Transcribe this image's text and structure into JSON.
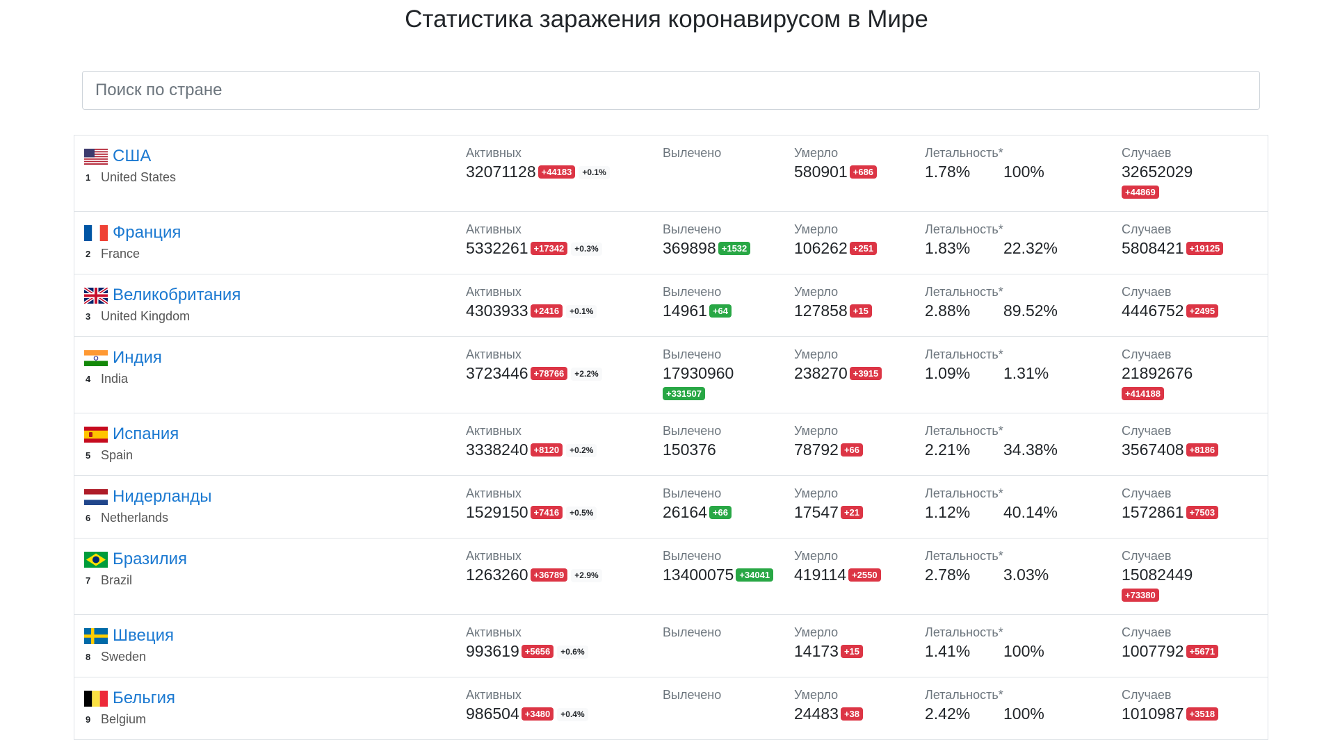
{
  "page": {
    "title": "Статистика заражения коронавирусом в Мире"
  },
  "search": {
    "placeholder": "Поиск по стране"
  },
  "labels": {
    "active": "Активных",
    "recovered": "Вылечено",
    "deaths": "Умерло",
    "lethality": "Летальность*",
    "cases": "Случаев"
  },
  "colors": {
    "link": "#1b79d1",
    "badge_red": "#dc3545",
    "badge_green": "#28a745"
  },
  "countries": [
    {
      "rank": "1",
      "name_ru": "США",
      "name_en": "United States",
      "flag": "us-flag",
      "active": "32071128",
      "active_delta": "+44183",
      "active_pct": "+0.1%",
      "recovered": "",
      "recovered_delta": "",
      "deaths": "580901",
      "deaths_delta": "+686",
      "lethality": "1.78%",
      "lethality2": "100%",
      "cases": "32652029",
      "cases_delta": "+44869"
    },
    {
      "rank": "2",
      "name_ru": "Франция",
      "name_en": "France",
      "flag": "fr-flag",
      "active": "5332261",
      "active_delta": "+17342",
      "active_pct": "+0.3%",
      "recovered": "369898",
      "recovered_delta": "+1532",
      "deaths": "106262",
      "deaths_delta": "+251",
      "lethality": "1.83%",
      "lethality2": "22.32%",
      "cases": "5808421",
      "cases_delta": "+19125"
    },
    {
      "rank": "3",
      "name_ru": "Великобритания",
      "name_en": "United Kingdom",
      "flag": "gb-flag",
      "active": "4303933",
      "active_delta": "+2416",
      "active_pct": "+0.1%",
      "recovered": "14961",
      "recovered_delta": "+64",
      "deaths": "127858",
      "deaths_delta": "+15",
      "lethality": "2.88%",
      "lethality2": "89.52%",
      "cases": "4446752",
      "cases_delta": "+2495"
    },
    {
      "rank": "4",
      "name_ru": "Индия",
      "name_en": "India",
      "flag": "in-flag",
      "active": "3723446",
      "active_delta": "+78766",
      "active_pct": "+2.2%",
      "recovered": "17930960",
      "recovered_delta": "+331507",
      "deaths": "238270",
      "deaths_delta": "+3915",
      "lethality": "1.09%",
      "lethality2": "1.31%",
      "cases": "21892676",
      "cases_delta": "+414188"
    },
    {
      "rank": "5",
      "name_ru": "Испания",
      "name_en": "Spain",
      "flag": "es-flag",
      "active": "3338240",
      "active_delta": "+8120",
      "active_pct": "+0.2%",
      "recovered": "150376",
      "recovered_delta": "",
      "deaths": "78792",
      "deaths_delta": "+66",
      "lethality": "2.21%",
      "lethality2": "34.38%",
      "cases": "3567408",
      "cases_delta": "+8186"
    },
    {
      "rank": "6",
      "name_ru": "Нидерланды",
      "name_en": "Netherlands",
      "flag": "nl-flag",
      "active": "1529150",
      "active_delta": "+7416",
      "active_pct": "+0.5%",
      "recovered": "26164",
      "recovered_delta": "+66",
      "deaths": "17547",
      "deaths_delta": "+21",
      "lethality": "1.12%",
      "lethality2": "40.14%",
      "cases": "1572861",
      "cases_delta": "+7503"
    },
    {
      "rank": "7",
      "name_ru": "Бразилия",
      "name_en": "Brazil",
      "flag": "br-flag",
      "active": "1263260",
      "active_delta": "+36789",
      "active_pct": "+2.9%",
      "recovered": "13400075",
      "recovered_delta": "+34041",
      "deaths": "419114",
      "deaths_delta": "+2550",
      "lethality": "2.78%",
      "lethality2": "3.03%",
      "cases": "15082449",
      "cases_delta": "+73380"
    },
    {
      "rank": "8",
      "name_ru": "Швеция",
      "name_en": "Sweden",
      "flag": "se-flag",
      "active": "993619",
      "active_delta": "+5656",
      "active_pct": "+0.6%",
      "recovered": "",
      "recovered_delta": "",
      "deaths": "14173",
      "deaths_delta": "+15",
      "lethality": "1.41%",
      "lethality2": "100%",
      "cases": "1007792",
      "cases_delta": "+5671"
    },
    {
      "rank": "9",
      "name_ru": "Бельгия",
      "name_en": "Belgium",
      "flag": "be-flag",
      "active": "986504",
      "active_delta": "+3480",
      "active_pct": "+0.4%",
      "recovered": "",
      "recovered_delta": "",
      "deaths": "24483",
      "deaths_delta": "+38",
      "lethality": "2.42%",
      "lethality2": "100%",
      "cases": "1010987",
      "cases_delta": "+3518"
    }
  ]
}
